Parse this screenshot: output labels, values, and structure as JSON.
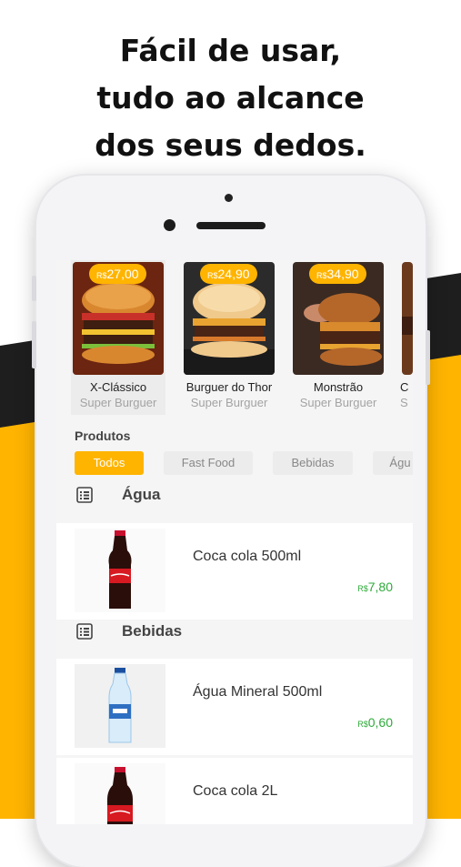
{
  "headline": {
    "line1": "Fácil de usar,",
    "line2": "tudo ao alcance",
    "line3": "dos seus dedos."
  },
  "colors": {
    "accent": "#FFB400",
    "dark_band": "#1e1e1e",
    "price_green": "#2eaa3a"
  },
  "currency": "R$",
  "featured": [
    {
      "price": "27,00",
      "name": "X-Clássico",
      "store": "Super Burguer",
      "selected": true
    },
    {
      "price": "24,90",
      "name": "Burguer do Thor",
      "store": "Super Burguer",
      "selected": false
    },
    {
      "price": "34,90",
      "name": "Monstrão",
      "store": "Super Burguer",
      "selected": false
    },
    {
      "price": "",
      "name": "C",
      "store": "S",
      "selected": false
    }
  ],
  "products_title": "Produtos",
  "chips": [
    {
      "label": "Todos",
      "active": true
    },
    {
      "label": "Fast Food",
      "active": false
    },
    {
      "label": "Bebidas",
      "active": false
    },
    {
      "label": "Águ",
      "active": false
    }
  ],
  "categories": [
    {
      "title": "Água",
      "icon": "list-icon",
      "products": [
        {
          "name": "Coca cola 500ml",
          "price": "7,80",
          "image": "coca-cola-bottle"
        }
      ]
    },
    {
      "title": "Bebidas",
      "icon": "list-icon",
      "products": [
        {
          "name": "Água Mineral 500ml",
          "price": "0,60",
          "image": "water-bottle"
        },
        {
          "name": "Coca cola 2L",
          "price": "",
          "image": "coca-cola-bottle"
        }
      ]
    }
  ]
}
